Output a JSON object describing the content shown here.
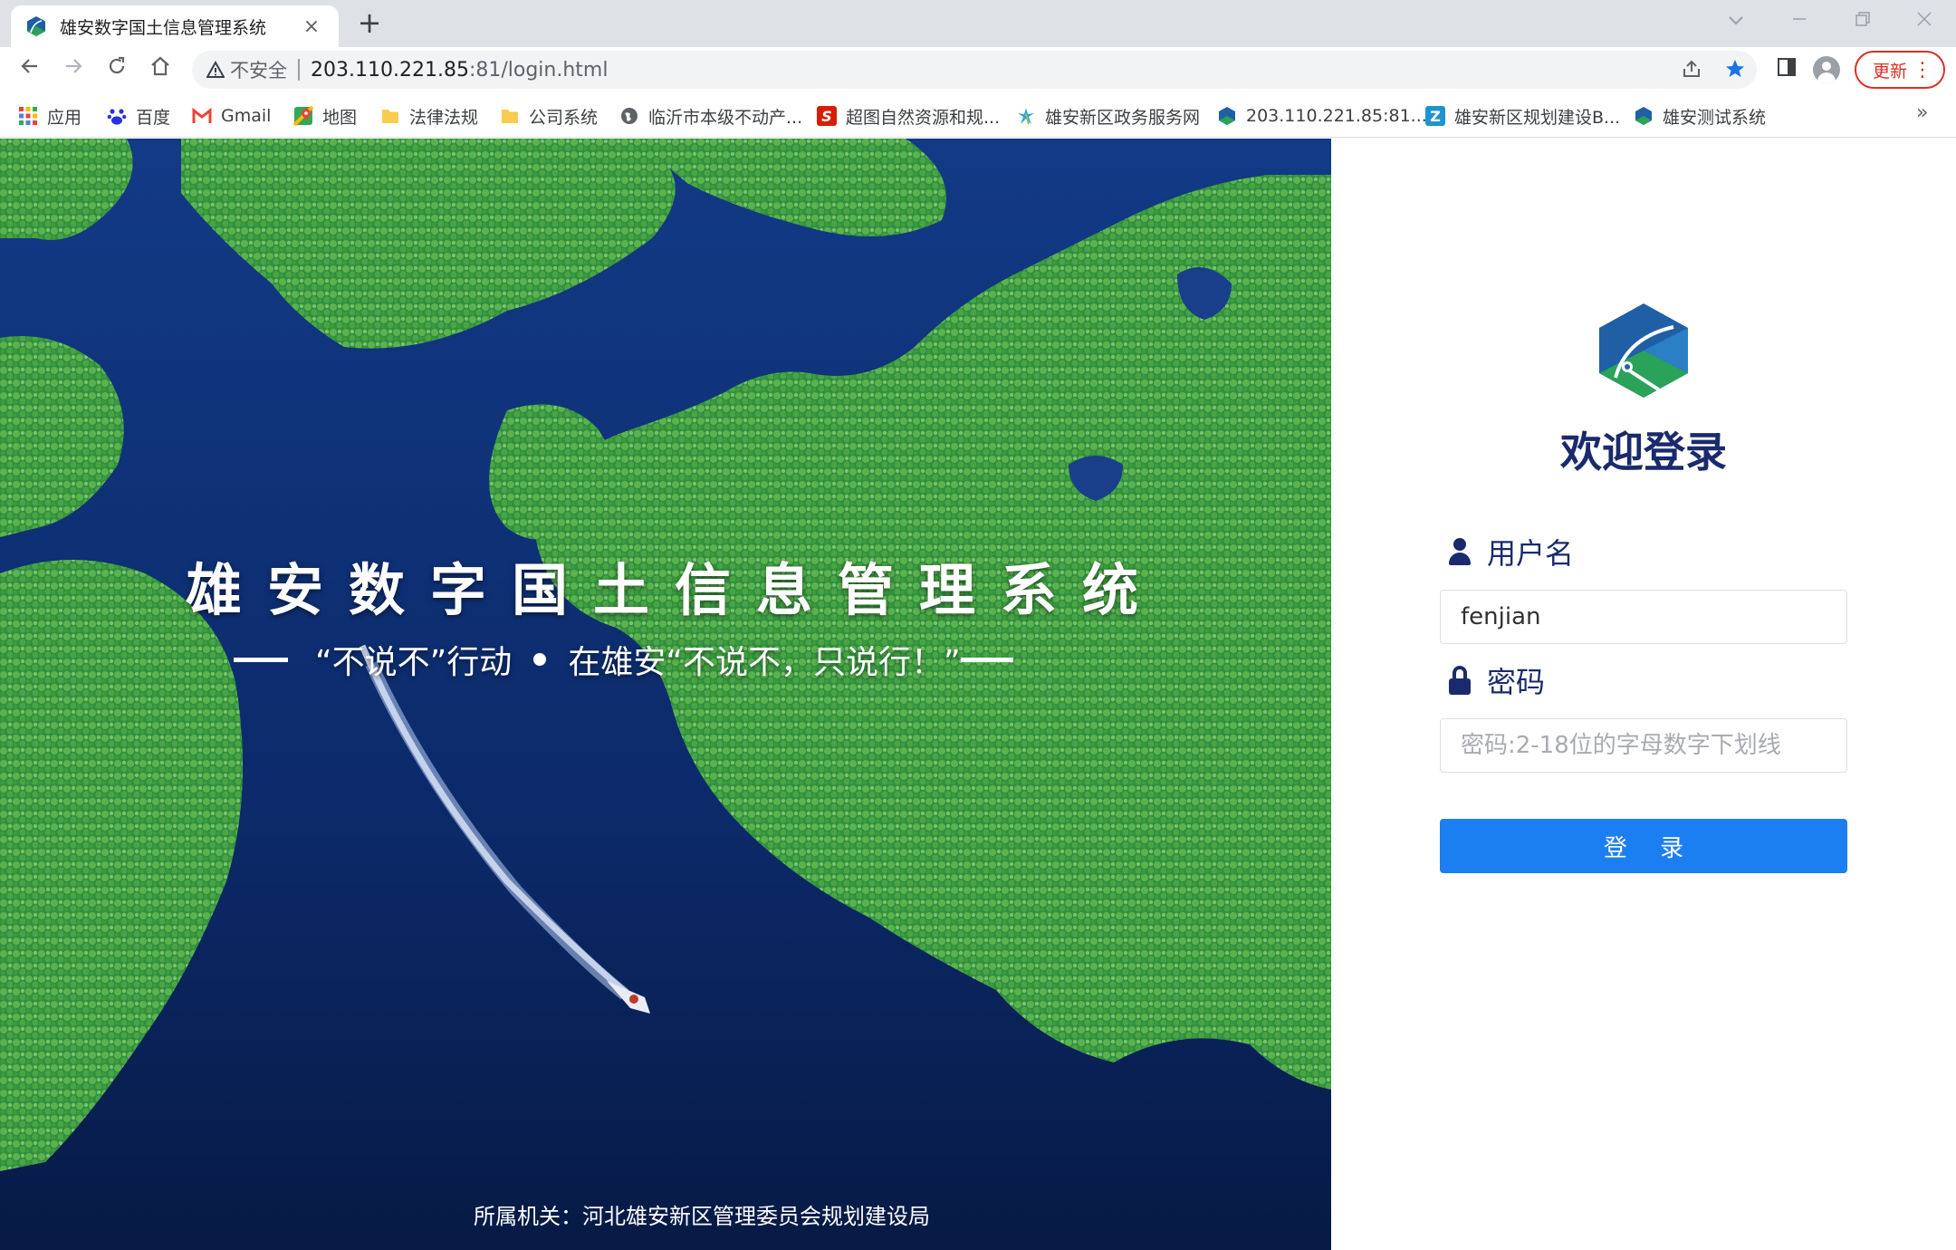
{
  "browser": {
    "tab_title": "雄安数字国土信息管理系统",
    "tab_close": "×",
    "new_tab": "+",
    "security_label": "不安全",
    "url_host": "203.110.221.85",
    "url_path": ":81/login.html",
    "update_label": "更新",
    "update_menu": "⋮"
  },
  "bookmarks": [
    {
      "label": "应用",
      "icon": "apps-grid-icon",
      "color": "#4285f4"
    },
    {
      "label": "百度",
      "icon": "baidu-paw-icon",
      "color": "#2932e1"
    },
    {
      "label": "Gmail",
      "icon": "gmail-icon",
      "color": "#ea4335"
    },
    {
      "label": "地图",
      "icon": "maps-pin-icon",
      "color": "#34a853"
    },
    {
      "label": "法律法规",
      "icon": "folder-icon",
      "color": "#f9cb4f"
    },
    {
      "label": "公司系统",
      "icon": "folder-icon",
      "color": "#f9cb4f"
    },
    {
      "label": "临沂市本级不动产...",
      "icon": "globe-icon",
      "color": "#5f6368"
    },
    {
      "label": "超图自然资源和规...",
      "icon": "supermap-s-icon",
      "color": "#d81e06"
    },
    {
      "label": "雄安新区政务服务网",
      "icon": "xiongan-gov-icon",
      "color": "#33a3dc"
    },
    {
      "label": "203.110.221.85:81...",
      "icon": "xiongan-logo-icon",
      "color": "#1f5fa6"
    },
    {
      "label": "雄安新区规划建设B...",
      "icon": "z-icon",
      "color": "#1f93d1"
    },
    {
      "label": "雄安测试系统",
      "icon": "xiongan-logo-icon",
      "color": "#1f5fa6"
    }
  ],
  "bookmarks_more": "»",
  "hero": {
    "title": "雄安数字国土信息管理系统",
    "slogan_part1": "“不说不”行动",
    "slogan_part2": "在雄安“不说不，只说行！”",
    "footer": "所属机关：河北雄安新区管理委员会规划建设局"
  },
  "login": {
    "welcome": "欢迎登录",
    "username_label": "用户名",
    "username_value": "fenjian",
    "password_label": "密码",
    "password_placeholder": "密码:2-18位的字母数字下划线",
    "submit_label": "登 录"
  },
  "colors": {
    "primary_button": "#1c7ff1",
    "heading": "#1a2a6c",
    "update_red": "#d93025"
  }
}
